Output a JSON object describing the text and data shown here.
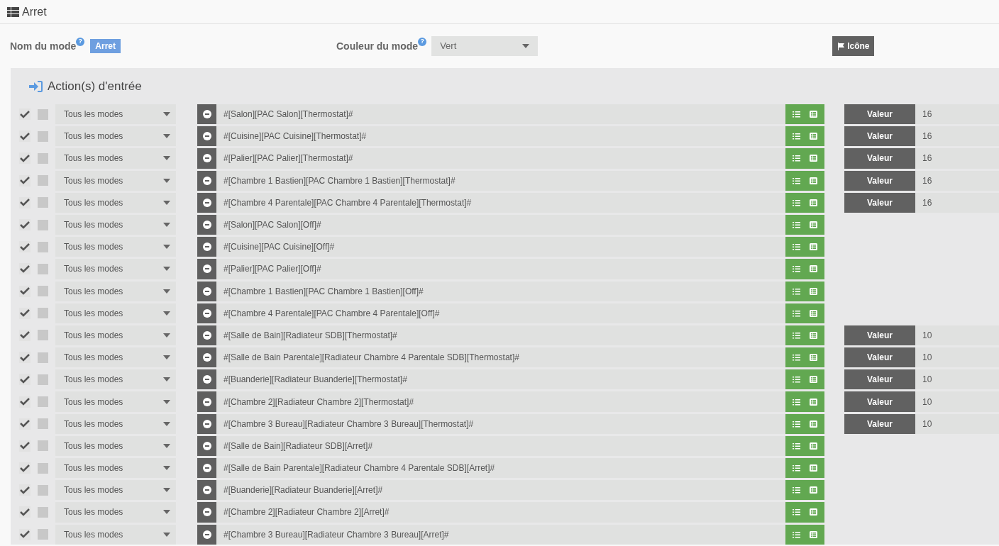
{
  "header": {
    "title": "Arret"
  },
  "mode": {
    "name_label": "Nom du mode",
    "help": "?",
    "name_value": "Arret",
    "color_label": "Couleur du mode",
    "color_help": "?",
    "color_value": "Vert",
    "icon_button": "Icône"
  },
  "section": {
    "title": "Action(s) d'entrée",
    "rows": [
      {
        "enabled": true,
        "checked": false,
        "mode": "Tous les modes",
        "command": "#[Salon][PAC Salon][Thermostat]#",
        "value_button": "Valeur",
        "value": "16"
      },
      {
        "enabled": true,
        "checked": false,
        "mode": "Tous les modes",
        "command": "#[Cuisine][PAC Cuisine][Thermostat]#",
        "value_button": "Valeur",
        "value": "16"
      },
      {
        "enabled": true,
        "checked": false,
        "mode": "Tous les modes",
        "command": "#[Palier][PAC Palier][Thermostat]#",
        "value_button": "Valeur",
        "value": "16"
      },
      {
        "enabled": true,
        "checked": false,
        "mode": "Tous les modes",
        "command": "#[Chambre 1 Bastien][PAC Chambre 1 Bastien][Thermostat]#",
        "value_button": "Valeur",
        "value": "16"
      },
      {
        "enabled": true,
        "checked": false,
        "mode": "Tous les modes",
        "command": "#[Chambre 4 Parentale][PAC Chambre 4 Parentale][Thermostat]#",
        "value_button": "Valeur",
        "value": "16"
      },
      {
        "enabled": true,
        "checked": false,
        "mode": "Tous les modes",
        "command": "#[Salon][PAC Salon][Off]#"
      },
      {
        "enabled": true,
        "checked": false,
        "mode": "Tous les modes",
        "command": "#[Cuisine][PAC Cuisine][Off]#"
      },
      {
        "enabled": true,
        "checked": false,
        "mode": "Tous les modes",
        "command": "#[Palier][PAC Palier][Off]#"
      },
      {
        "enabled": true,
        "checked": false,
        "mode": "Tous les modes",
        "command": "#[Chambre 1 Bastien][PAC Chambre 1 Bastien][Off]#"
      },
      {
        "enabled": true,
        "checked": false,
        "mode": "Tous les modes",
        "command": "#[Chambre 4 Parentale][PAC Chambre 4 Parentale][Off]#"
      },
      {
        "enabled": true,
        "checked": false,
        "mode": "Tous les modes",
        "command": "#[Salle de Bain][Radiateur SDB][Thermostat]#",
        "value_button": "Valeur",
        "value": "10"
      },
      {
        "enabled": true,
        "checked": false,
        "mode": "Tous les modes",
        "command": "#[Salle de Bain Parentale][Radiateur Chambre 4 Parentale SDB][Thermostat]#",
        "value_button": "Valeur",
        "value": "10"
      },
      {
        "enabled": true,
        "checked": false,
        "mode": "Tous les modes",
        "command": "#[Buanderie][Radiateur Buanderie][Thermostat]#",
        "value_button": "Valeur",
        "value": "10"
      },
      {
        "enabled": true,
        "checked": false,
        "mode": "Tous les modes",
        "command": "#[Chambre 2][Radiateur Chambre 2][Thermostat]#",
        "value_button": "Valeur",
        "value": "10"
      },
      {
        "enabled": true,
        "checked": false,
        "mode": "Tous les modes",
        "command": "#[Chambre 3 Bureau][Radiateur Chambre 3 Bureau][Thermostat]#",
        "value_button": "Valeur",
        "value": "10"
      },
      {
        "enabled": true,
        "checked": false,
        "mode": "Tous les modes",
        "command": "#[Salle de Bain][Radiateur SDB][Arret]#"
      },
      {
        "enabled": true,
        "checked": false,
        "mode": "Tous les modes",
        "command": "#[Salle de Bain Parentale][Radiateur Chambre 4 Parentale SDB][Arret]#"
      },
      {
        "enabled": true,
        "checked": false,
        "mode": "Tous les modes",
        "command": "#[Buanderie][Radiateur Buanderie][Arret]#"
      },
      {
        "enabled": true,
        "checked": false,
        "mode": "Tous les modes",
        "command": "#[Chambre 2][Radiateur Chambre 2][Arret]#"
      },
      {
        "enabled": true,
        "checked": false,
        "mode": "Tous les modes",
        "command": "#[Chambre 3 Bureau][Radiateur Chambre 3 Bureau][Arret]#"
      }
    ]
  }
}
